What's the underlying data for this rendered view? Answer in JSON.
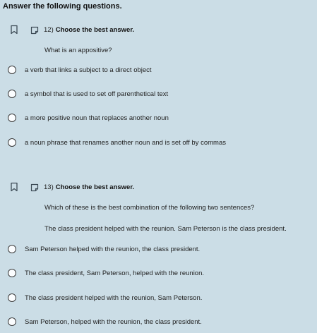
{
  "page": {
    "title": "Answer the following questions."
  },
  "questions": [
    {
      "number": "12)",
      "instruction": "Choose the best answer.",
      "prompts": [
        "What is an appositive?"
      ],
      "choices": [
        "a verb that links a subject to a direct object",
        "a symbol that is used to set off parenthetical text",
        "a more positive noun that replaces another noun",
        "a noun phrase that renames another noun and is set off by commas"
      ]
    },
    {
      "number": "13)",
      "instruction": "Choose the best answer.",
      "prompts": [
        "Which of these is the best combination of the following two sentences?",
        "The class president helped with the reunion. Sam Peterson is the class president."
      ],
      "choices": [
        "Sam Peterson helped with the reunion, the class president.",
        "The class president, Sam Peterson, helped with the reunion.",
        "The class president helped with the reunion, Sam Peterson.",
        "Sam Peterson, helped with the reunion, the class president."
      ]
    }
  ]
}
